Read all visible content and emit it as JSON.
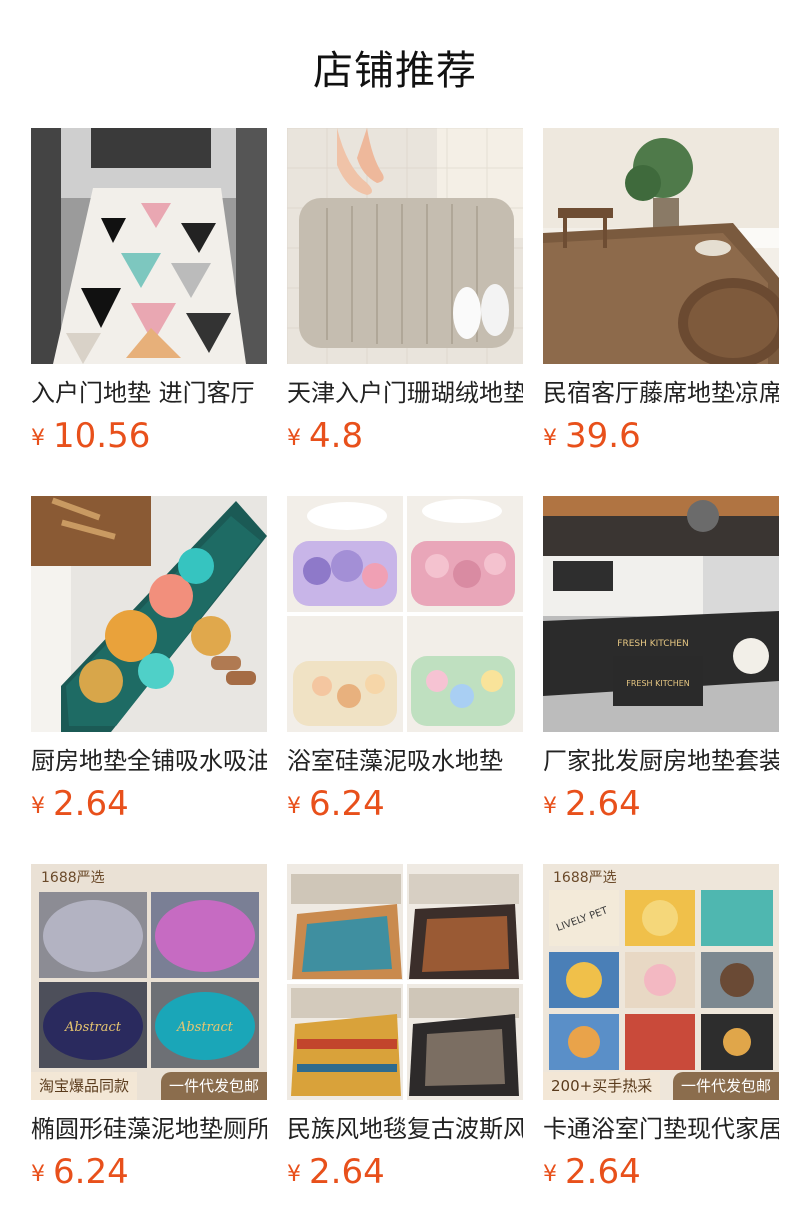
{
  "page": {
    "title": "店铺推荐"
  },
  "currency": "¥",
  "products": [
    {
      "name": "入户门地垫 进门客厅",
      "price": "10.56"
    },
    {
      "name": "天津入户门珊瑚绒地垫",
      "price": "4.8"
    },
    {
      "name": "民宿客厅藤席地垫凉席",
      "price": "39.6"
    },
    {
      "name": "厨房地垫全铺吸水吸油",
      "price": "2.64"
    },
    {
      "name": "浴室硅藻泥吸水地垫",
      "price": "6.24"
    },
    {
      "name": "厂家批发厨房地垫套装",
      "price": "2.64"
    },
    {
      "name": "椭圆形硅藻泥地垫厕所",
      "price": "6.24",
      "badges": {
        "top": "1688严选",
        "bottom_left": "淘宝爆品同款",
        "bottom_right": "一件代发包邮"
      }
    },
    {
      "name": "民族风地毯复古波斯风",
      "price": "2.64"
    },
    {
      "name": "卡通浴室门垫现代家居",
      "price": "2.64",
      "badges": {
        "top": "1688严选",
        "bottom_left": "200+买手热采",
        "bottom_right": "一件代发包邮"
      }
    }
  ],
  "images": [
    "geometric-triangle-mat-photo",
    "beige-bath-mat-photo",
    "rattan-rug-photo",
    "ginkgo-kitchen-mat-photo",
    "flower-bath-mats-photo",
    "fresh-kitchen-mat-photo",
    "oval-marble-mats-photo",
    "ethnic-rugs-photo",
    "cartoon-animal-mats-photo"
  ],
  "colors": {
    "price": "#e8501b",
    "title": "#111111"
  },
  "fresh_kitchen_text": "FRESH KITCHEN",
  "abstract_text": "Abstract",
  "lively_text": "LIVELY PET"
}
